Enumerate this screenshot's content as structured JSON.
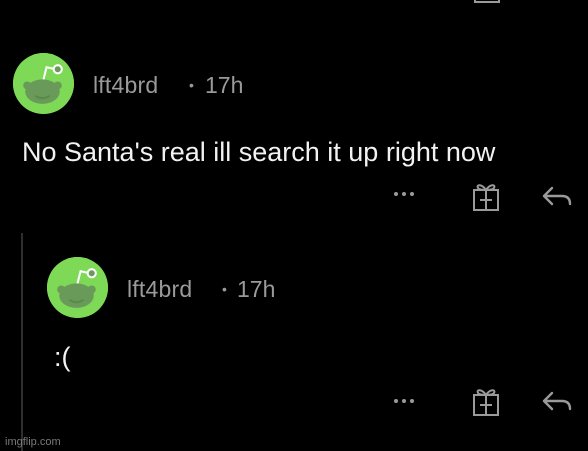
{
  "comments": [
    {
      "username": "lft4brd",
      "separator": "•",
      "age": "17h",
      "body": "No Santa's real ill search it up right now",
      "avatar_color": "#7ed957",
      "actions": [
        "more-icon",
        "gift-icon",
        "reply-icon"
      ]
    },
    {
      "username": "lft4brd",
      "separator": "•",
      "age": "17h",
      "body": ":(",
      "avatar_color": "#7ed957",
      "actions": [
        "more-icon",
        "gift-icon",
        "reply-icon"
      ]
    }
  ],
  "watermark": "imgflip.com"
}
